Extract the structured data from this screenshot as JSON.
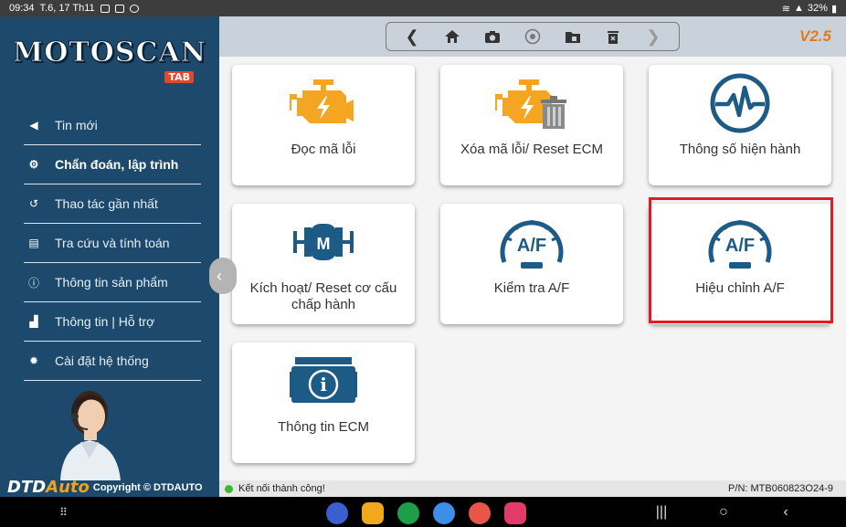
{
  "status_bar": {
    "time": "09:34",
    "date": "T.6, 17 Th11",
    "battery": "32%"
  },
  "logo": {
    "title": "MOTOSCAN",
    "sub": "TAB"
  },
  "sidebar": {
    "items": [
      {
        "label": "Tin mới"
      },
      {
        "label": "Chẩn đoán, lập trình"
      },
      {
        "label": "Thao tác gần nhất"
      },
      {
        "label": "Tra cứu và tính toán"
      },
      {
        "label": "Thông tin sản phẩm"
      },
      {
        "label": "Thông tin | Hỗ trợ"
      },
      {
        "label": "Cài đặt hệ thống"
      }
    ],
    "brand_a": "DTD",
    "brand_b": "Auto",
    "copyright": "Copyright © DTDAUTO"
  },
  "toolbar": {
    "version": "V2.5"
  },
  "tiles": [
    {
      "label": "Đọc mã lỗi",
      "icon": "engine-icon"
    },
    {
      "label": "Xóa mã lỗi/ Reset ECM",
      "icon": "engine-trash-icon"
    },
    {
      "label": "Thông số hiện hành",
      "icon": "pulse-icon"
    },
    {
      "label": "Kích hoạt/ Reset cơ cấu chấp hành",
      "icon": "motor-icon",
      "icon_text": "M"
    },
    {
      "label": "Kiểm tra A/F",
      "icon": "af-gauge-icon",
      "icon_text": "A/F"
    },
    {
      "label": "Hiệu chỉnh A/F",
      "icon": "af-gauge-icon",
      "icon_text": "A/F"
    },
    {
      "label": "Thông tin ECM",
      "icon": "ecm-info-icon",
      "icon_text": "i"
    }
  ],
  "colors": {
    "sidebar": "#1d4a6c",
    "accent": "#f0a21a",
    "icon_blue": "#1c5b86",
    "highlight": "#e01b22"
  },
  "connection": {
    "status": "Kết nối thành công!",
    "pn": "P/N: MTB060823O24-9"
  }
}
